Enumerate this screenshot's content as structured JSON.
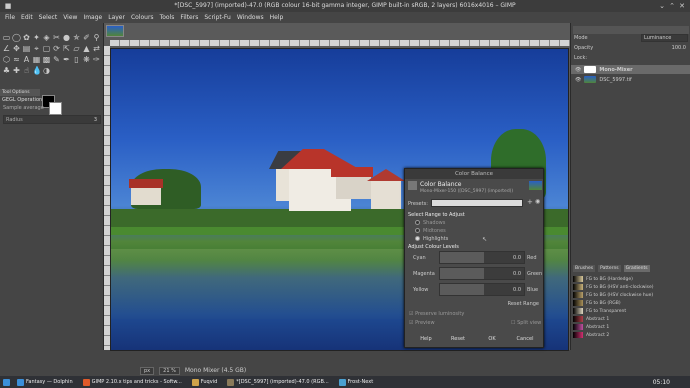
{
  "window": {
    "title": "*[DSC_5997] (imported)-47.0 (RGB colour 16-bit gamma integer, GIMP built-in sRGB, 2 layers) 6016x4016 – GIMP"
  },
  "menu": [
    "File",
    "Edit",
    "Select",
    "View",
    "Image",
    "Layer",
    "Colours",
    "Tools",
    "Filters",
    "Script-Fu",
    "Windows",
    "Help"
  ],
  "tool_options": {
    "tab": "Tool Options",
    "section": "GEGL Operation",
    "sample": "Sample average",
    "radius_label": "Radius",
    "radius_value": "3"
  },
  "status": {
    "unit": "px",
    "zoom": "21 %",
    "info": "Mono Mixer (4.5 GB)"
  },
  "layers_panel": {
    "mode_label": "Mode",
    "mode_value": "Luminance",
    "opacity_label": "Opacity",
    "opacity_value": "100.0",
    "lock_label": "Lock:",
    "layers": [
      {
        "name": "Mono-Mixer"
      },
      {
        "name": "DSC_5997.tif"
      }
    ]
  },
  "brushes_panel": {
    "tabs": [
      "Brushes",
      "Patterns",
      "Gradients"
    ],
    "gradients": [
      {
        "name": "FG to BG (Hardedge)",
        "color": "#d8c89a"
      },
      {
        "name": "FG to BG (HSV anti-clockwise)",
        "color": "#c9b37a"
      },
      {
        "name": "FG to BG (HSV clockwise hue)",
        "color": "#b8a06a"
      },
      {
        "name": "FG to BG (RGB)",
        "color": "#a89058"
      },
      {
        "name": "FG to Transparent",
        "color": "#e0d8c0"
      },
      {
        "name": "Abstract 1",
        "color": "#b0404a"
      },
      {
        "name": "Abstract 1",
        "color": "#c050a0"
      },
      {
        "name": "Abstract 2",
        "color": "#d03070"
      }
    ]
  },
  "dialog": {
    "title": "Color Balance",
    "heading": "Color Balance",
    "subheading": "Mono-Mixer-150 ([DSC_5997] (imported))",
    "presets_label": "Presets:",
    "range_label": "Select Range to Adjust",
    "ranges": [
      "Shadows",
      "Midtones",
      "Highlights"
    ],
    "levels_label": "Adjust Colour Levels",
    "sliders": [
      {
        "left": "Cyan",
        "right": "Red",
        "value": "0.0"
      },
      {
        "left": "Magenta",
        "right": "Green",
        "value": "0.0"
      },
      {
        "left": "Yellow",
        "right": "Blue",
        "value": "0.0"
      }
    ],
    "reset_range": "Reset Range",
    "preserve": "Preserve luminosity",
    "preview": "Preview",
    "split": "Split view",
    "buttons": {
      "help": "Help",
      "reset": "Reset",
      "ok": "OK",
      "cancel": "Cancel"
    }
  },
  "taskbar": {
    "tasks": [
      {
        "label": "Fantasy — Dolphin",
        "color": "#3b8fd9"
      },
      {
        "label": "GIMP 2.10.x tips and tricks - Softw...",
        "color": "#e05a2a"
      },
      {
        "label": "Fuqvid",
        "color": "#cfa34a"
      },
      {
        "label": "*[DSC_5997] (imported)-47.0 (RGB...",
        "color": "#8a7a5a"
      },
      {
        "label": "Frost-Next",
        "color": "#4aa0d0"
      }
    ],
    "clock": "05:10"
  }
}
